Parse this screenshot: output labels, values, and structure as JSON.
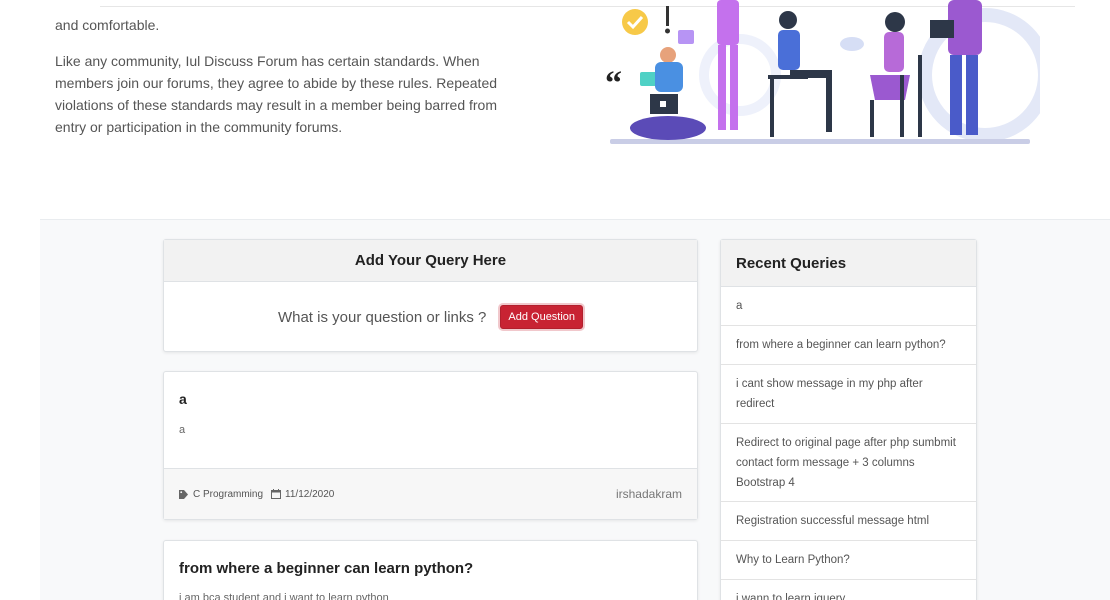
{
  "intro": {
    "para1_tail": "and comfortable.",
    "para2": "Like any community, Iul Discuss Forum has certain standards. When members join our forums, they agree to abide by these rules. Repeated violations of these standards may result in a member being barred from entry or participation in the community forums."
  },
  "query_card": {
    "header": "Add Your Query Here",
    "prompt": "What is your question or links ?",
    "button": "Add Question"
  },
  "posts": [
    {
      "title": "a",
      "body": "a",
      "category": "C Programming",
      "date": "11/12/2020",
      "user": "irshadakram"
    },
    {
      "title": "from where a beginner can learn python?",
      "body": "i am bca student and i want to learn python"
    }
  ],
  "recent": {
    "header": "Recent Queries",
    "items": [
      "a",
      "from where a beginner can learn python?",
      "i cant show message in my php after redirect",
      "Redirect to original page after php sumbmit contact form message + 3 columns Bootstrap 4",
      "Registration successful message html",
      "Why to Learn Python?",
      "i wann to learn jquery"
    ]
  },
  "colors": {
    "accent_red": "#c82333",
    "band_bg": "#f8f9fa",
    "illustration_purple": "#9b59d0",
    "illustration_blue": "#4a6fd8"
  }
}
